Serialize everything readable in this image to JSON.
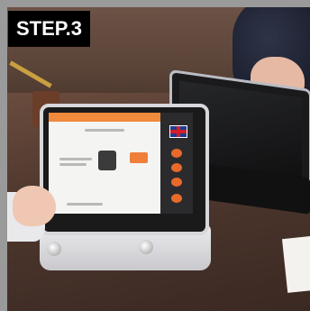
{
  "step_label": "STEP.3",
  "colors": {
    "border": "#9a9a9a",
    "label_background": "#000000",
    "label_text": "#ffffff",
    "screen_accent": "#f08a3c"
  }
}
